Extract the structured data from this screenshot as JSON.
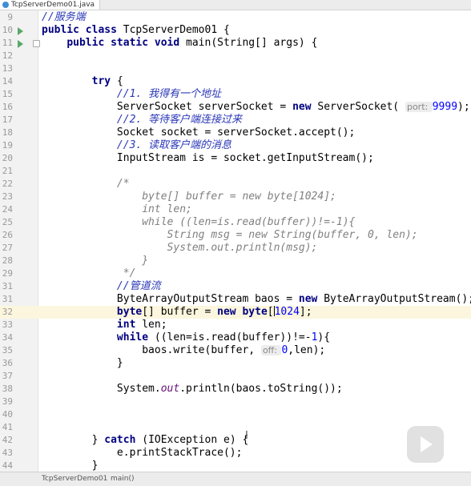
{
  "tab": {
    "file_name": "TcpServerDemo01.java"
  },
  "lines": [
    {
      "n": "9",
      "tokens": [
        [
          "",
          ""
        ],
        [
          "zc",
          "//服务端"
        ]
      ]
    },
    {
      "n": "10",
      "run": true,
      "tokens": [
        [
          "kw",
          "public class "
        ],
        [
          "",
          "TcpServerDemo01 {"
        ]
      ]
    },
    {
      "n": "11",
      "run": true,
      "fold": true,
      "tokens": [
        [
          "",
          "    "
        ],
        [
          "kw",
          "public static void "
        ],
        [
          "",
          "main(String[] args) {"
        ]
      ]
    },
    {
      "n": "12",
      "tokens": []
    },
    {
      "n": "13",
      "tokens": []
    },
    {
      "n": "14",
      "tokens": [
        [
          "",
          "        "
        ],
        [
          "kw",
          "try "
        ],
        [
          "",
          "{"
        ]
      ]
    },
    {
      "n": "15",
      "tokens": [
        [
          "",
          "            "
        ],
        [
          "zc",
          "//1. 我得有一个地址"
        ]
      ]
    },
    {
      "n": "16",
      "tokens": [
        [
          "",
          "            ServerSocket serverSocket = "
        ],
        [
          "kw",
          "new "
        ],
        [
          "",
          "ServerSocket( "
        ],
        [
          "hint",
          "port: "
        ],
        [
          "num",
          "9999"
        ],
        [
          "",
          ");"
        ]
      ]
    },
    {
      "n": "17",
      "tokens": [
        [
          "",
          "            "
        ],
        [
          "zc",
          "//2. 等待客户端连接过来"
        ]
      ]
    },
    {
      "n": "18",
      "tokens": [
        [
          "",
          "            Socket socket = serverSocket.accept();"
        ]
      ]
    },
    {
      "n": "19",
      "tokens": [
        [
          "",
          "            "
        ],
        [
          "zc",
          "//3. 读取客户端的消息"
        ]
      ]
    },
    {
      "n": "20",
      "tokens": [
        [
          "",
          "            InputStream is = socket.getInputStream();"
        ]
      ]
    },
    {
      "n": "21",
      "tokens": []
    },
    {
      "n": "22",
      "tokens": [
        [
          "",
          "            "
        ],
        [
          "cm",
          "/*"
        ]
      ]
    },
    {
      "n": "23",
      "tokens": [
        [
          "",
          "                "
        ],
        [
          "cm",
          "byte[] buffer = new byte[1024];"
        ]
      ]
    },
    {
      "n": "24",
      "tokens": [
        [
          "",
          "                "
        ],
        [
          "cm",
          "int len;"
        ]
      ]
    },
    {
      "n": "25",
      "tokens": [
        [
          "",
          "                "
        ],
        [
          "cm",
          "while ((len=is.read(buffer))!=-1){"
        ]
      ]
    },
    {
      "n": "26",
      "tokens": [
        [
          "",
          "                    "
        ],
        [
          "cm",
          "String msg = new String(buffer, 0, len);"
        ]
      ]
    },
    {
      "n": "27",
      "tokens": [
        [
          "",
          "                    "
        ],
        [
          "cm",
          "System.out.println(msg);"
        ]
      ]
    },
    {
      "n": "28",
      "tokens": [
        [
          "",
          "                "
        ],
        [
          "cm",
          "}"
        ]
      ]
    },
    {
      "n": "29",
      "tokens": [
        [
          "",
          "             "
        ],
        [
          "cm",
          "*/"
        ]
      ]
    },
    {
      "n": "31",
      "tokens": [
        [
          "",
          "            "
        ],
        [
          "zc",
          "//管道流"
        ]
      ]
    },
    {
      "n": "31",
      "tokens": [
        [
          "",
          "            ByteArrayOutputStream baos = "
        ],
        [
          "kw",
          "new "
        ],
        [
          "",
          "ByteArrayOutputStream();"
        ]
      ]
    },
    {
      "n": "32",
      "hl": true,
      "tokens": [
        [
          "",
          "            "
        ],
        [
          "kw",
          "byte"
        ],
        [
          "",
          "[] buffer = "
        ],
        [
          "kw",
          "new byte"
        ],
        [
          "",
          "["
        ],
        [
          "caret",
          ""
        ],
        [
          "num",
          "1024"
        ],
        [
          "",
          "];"
        ]
      ]
    },
    {
      "n": "33",
      "tokens": [
        [
          "",
          "            "
        ],
        [
          "kw",
          "int "
        ],
        [
          "",
          "len;"
        ]
      ]
    },
    {
      "n": "34",
      "tokens": [
        [
          "",
          "            "
        ],
        [
          "kw",
          "while "
        ],
        [
          "",
          "((len=is.read(buffer))!=-"
        ],
        [
          "num",
          "1"
        ],
        [
          "",
          "){"
        ]
      ]
    },
    {
      "n": "35",
      "tokens": [
        [
          "",
          "                baos.write(buffer, "
        ],
        [
          "hint",
          "off: "
        ],
        [
          "num",
          "0"
        ],
        [
          "",
          ",len);"
        ]
      ]
    },
    {
      "n": "36",
      "tokens": [
        [
          "",
          "            }"
        ]
      ]
    },
    {
      "n": "37",
      "tokens": []
    },
    {
      "n": "38",
      "tokens": [
        [
          "",
          "            System."
        ],
        [
          "fld",
          "out"
        ],
        [
          "",
          ".println(baos.toString());"
        ]
      ]
    },
    {
      "n": "39",
      "tokens": []
    },
    {
      "n": "40",
      "tokens": []
    },
    {
      "n": "41",
      "tokens": []
    },
    {
      "n": "42",
      "tokens": [
        [
          "",
          "        } "
        ],
        [
          "kw",
          "catch "
        ],
        [
          "",
          "(IOException e) {"
        ]
      ]
    },
    {
      "n": "43",
      "tokens": [
        [
          "",
          "            e.printStackTrace();"
        ]
      ]
    },
    {
      "n": "44",
      "tokens": [
        [
          "",
          "        }"
        ]
      ]
    }
  ],
  "statusbar": {
    "class_crumb": "TcpServerDemo01",
    "method_crumb": "main()"
  }
}
